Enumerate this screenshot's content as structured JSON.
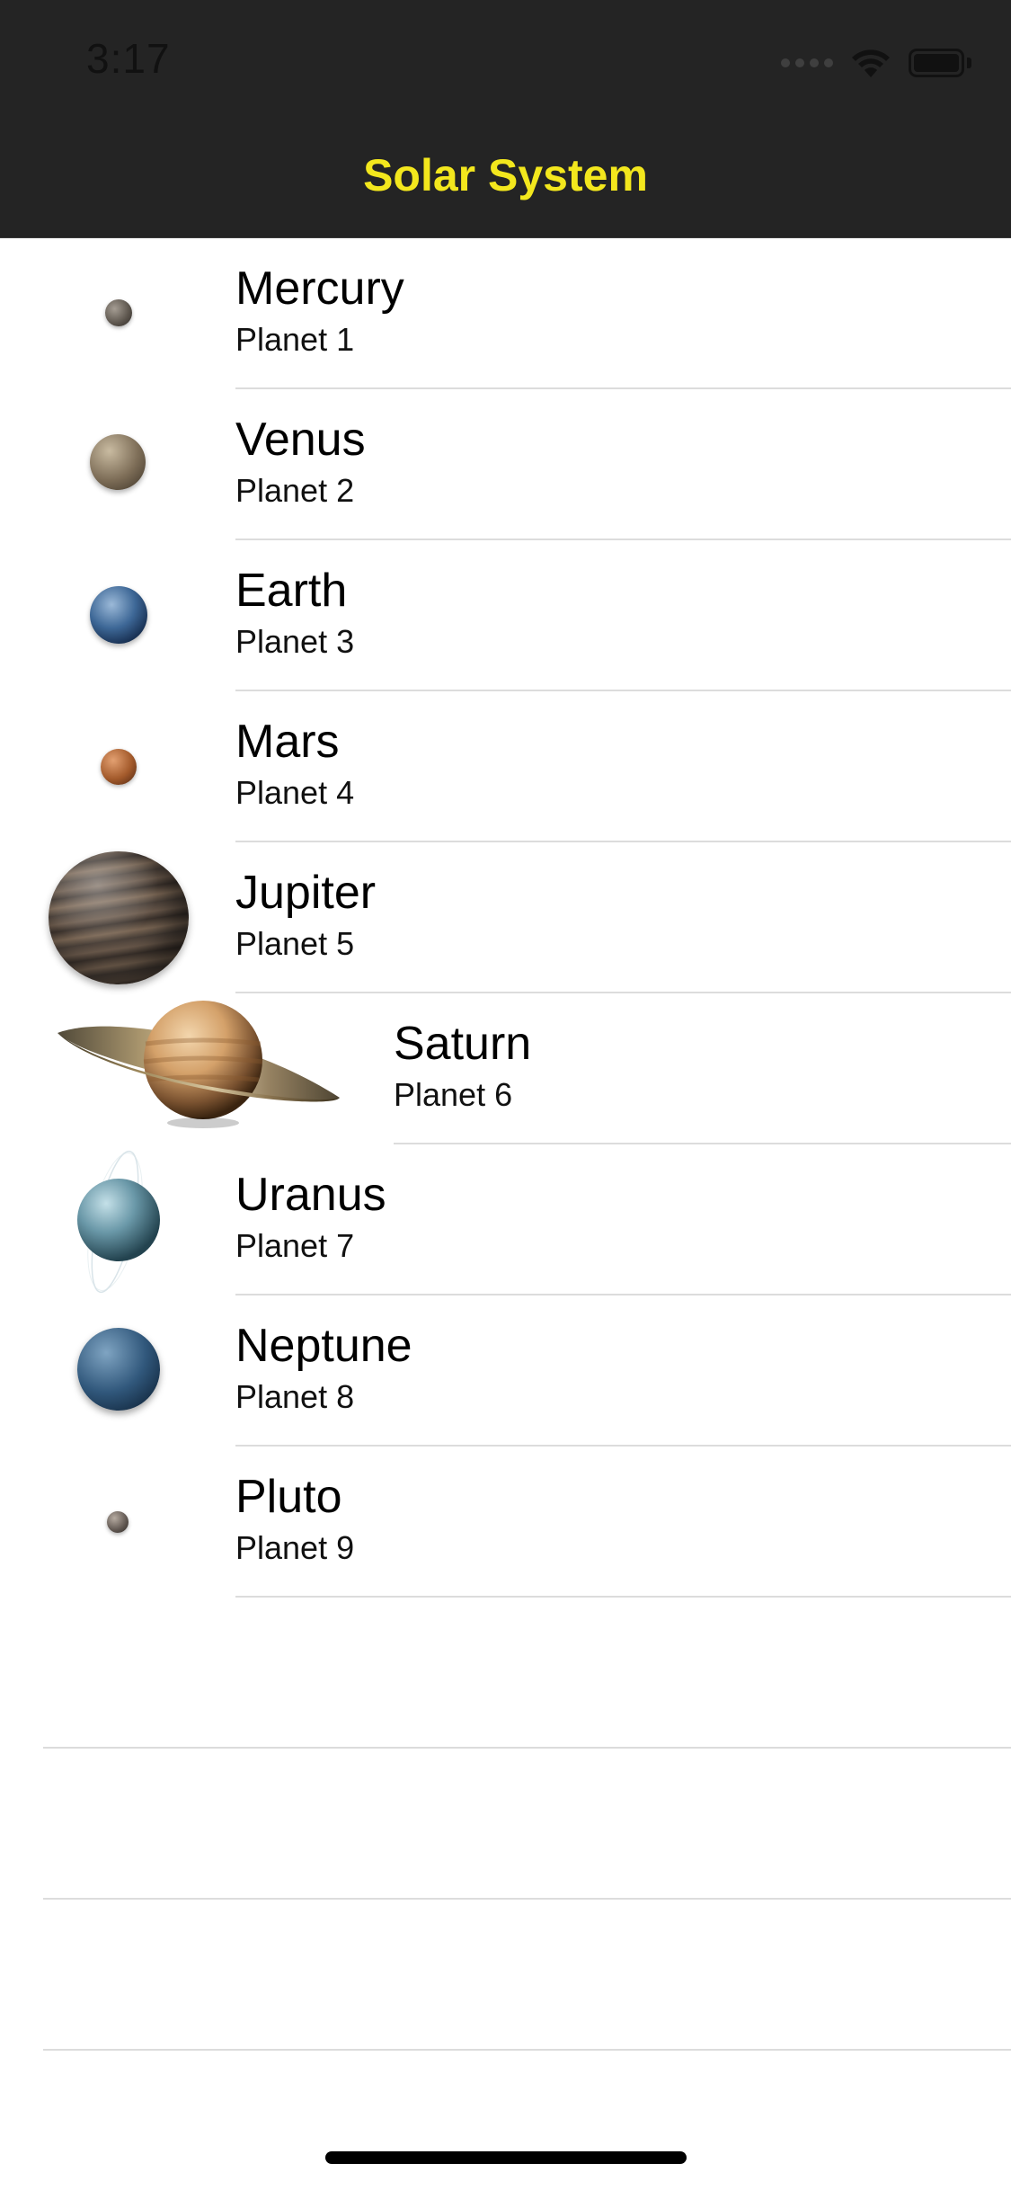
{
  "status_bar": {
    "time": "3:17",
    "signal_icon": "cellular-signal-dots",
    "wifi_icon": "wifi-icon",
    "battery_icon": "battery-icon"
  },
  "nav": {
    "title": "Solar System",
    "title_color": "#f3e71d",
    "background": "#242424"
  },
  "planets": [
    {
      "name": "Mercury",
      "subtitle": "Planet 1",
      "icon": "mercury-icon"
    },
    {
      "name": "Venus",
      "subtitle": "Planet 2",
      "icon": "venus-icon"
    },
    {
      "name": "Earth",
      "subtitle": "Planet 3",
      "icon": "earth-icon"
    },
    {
      "name": "Mars",
      "subtitle": "Planet 4",
      "icon": "mars-icon"
    },
    {
      "name": "Jupiter",
      "subtitle": "Planet 5",
      "icon": "jupiter-icon"
    },
    {
      "name": "Saturn",
      "subtitle": "Planet 6",
      "icon": "saturn-icon"
    },
    {
      "name": "Uranus",
      "subtitle": "Planet 7",
      "icon": "uranus-icon"
    },
    {
      "name": "Neptune",
      "subtitle": "Planet 8",
      "icon": "neptune-icon"
    },
    {
      "name": "Pluto",
      "subtitle": "Planet 9",
      "icon": "pluto-icon"
    }
  ]
}
